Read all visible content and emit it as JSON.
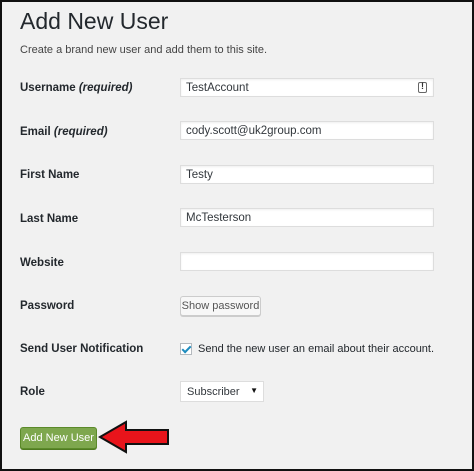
{
  "page": {
    "title": "Add New User",
    "subtitle": "Create a brand new user and add them to this site."
  },
  "form": {
    "username": {
      "label": "Username",
      "required": "(required)",
      "value": "TestAccount"
    },
    "email": {
      "label": "Email",
      "required": "(required)",
      "value": "cody.scott@uk2group.com"
    },
    "first_name": {
      "label": "First Name",
      "value": "Testy"
    },
    "last_name": {
      "label": "Last Name",
      "value": "McTesterson"
    },
    "website": {
      "label": "Website",
      "value": ""
    },
    "password": {
      "label": "Password",
      "button": "Show password"
    },
    "notification": {
      "label": "Send User Notification",
      "checkbox_text": "Send the new user an email about their account.",
      "checked": true
    },
    "role": {
      "label": "Role",
      "selected": "Subscriber"
    }
  },
  "actions": {
    "submit": "Add New User"
  },
  "colors": {
    "submit_bg": "#7ea74e",
    "arrow": "#e8141b"
  }
}
